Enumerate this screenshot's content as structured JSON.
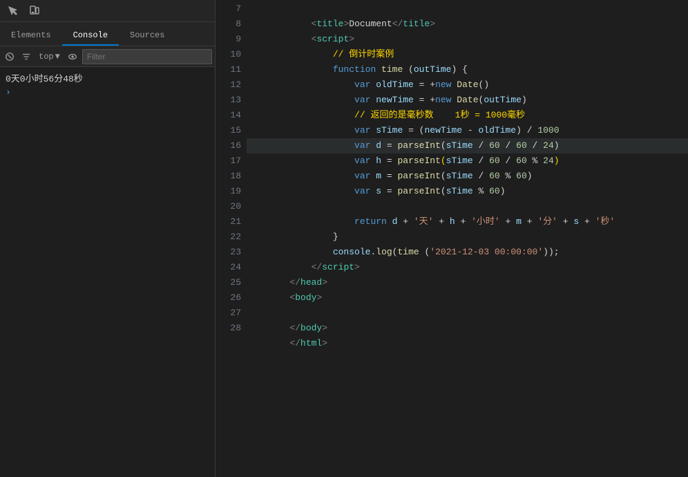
{
  "devtools": {
    "tabs": [
      "Elements",
      "Console",
      "Sources"
    ],
    "active_tab": "Console",
    "toolbar": {
      "top_label": "top",
      "filter_placeholder": "Filter"
    },
    "console_output": "0天0小时56分48秒"
  },
  "editor": {
    "lines": [
      {
        "num": 7,
        "content": "title_line"
      },
      {
        "num": 8,
        "content": "script_open"
      },
      {
        "num": 9,
        "content": "comment_countdown"
      },
      {
        "num": 10,
        "content": "func_decl"
      },
      {
        "num": 11,
        "content": "var_oldtime"
      },
      {
        "num": 12,
        "content": "var_newtime"
      },
      {
        "num": 13,
        "content": "comment_return"
      },
      {
        "num": 14,
        "content": "var_stime"
      },
      {
        "num": 15,
        "content": "var_d"
      },
      {
        "num": 16,
        "content": "var_h",
        "highlighted": true
      },
      {
        "num": 17,
        "content": "var_m"
      },
      {
        "num": 18,
        "content": "var_s"
      },
      {
        "num": 19,
        "content": "empty"
      },
      {
        "num": 20,
        "content": "return_stmt"
      },
      {
        "num": 21,
        "content": "close_brace"
      },
      {
        "num": 22,
        "content": "console_log"
      },
      {
        "num": 23,
        "content": "script_close"
      },
      {
        "num": 24,
        "content": "head_close"
      },
      {
        "num": 25,
        "content": "body_open"
      },
      {
        "num": 26,
        "content": "empty"
      },
      {
        "num": 27,
        "content": "body_close"
      },
      {
        "num": 28,
        "content": "html_close"
      }
    ]
  }
}
